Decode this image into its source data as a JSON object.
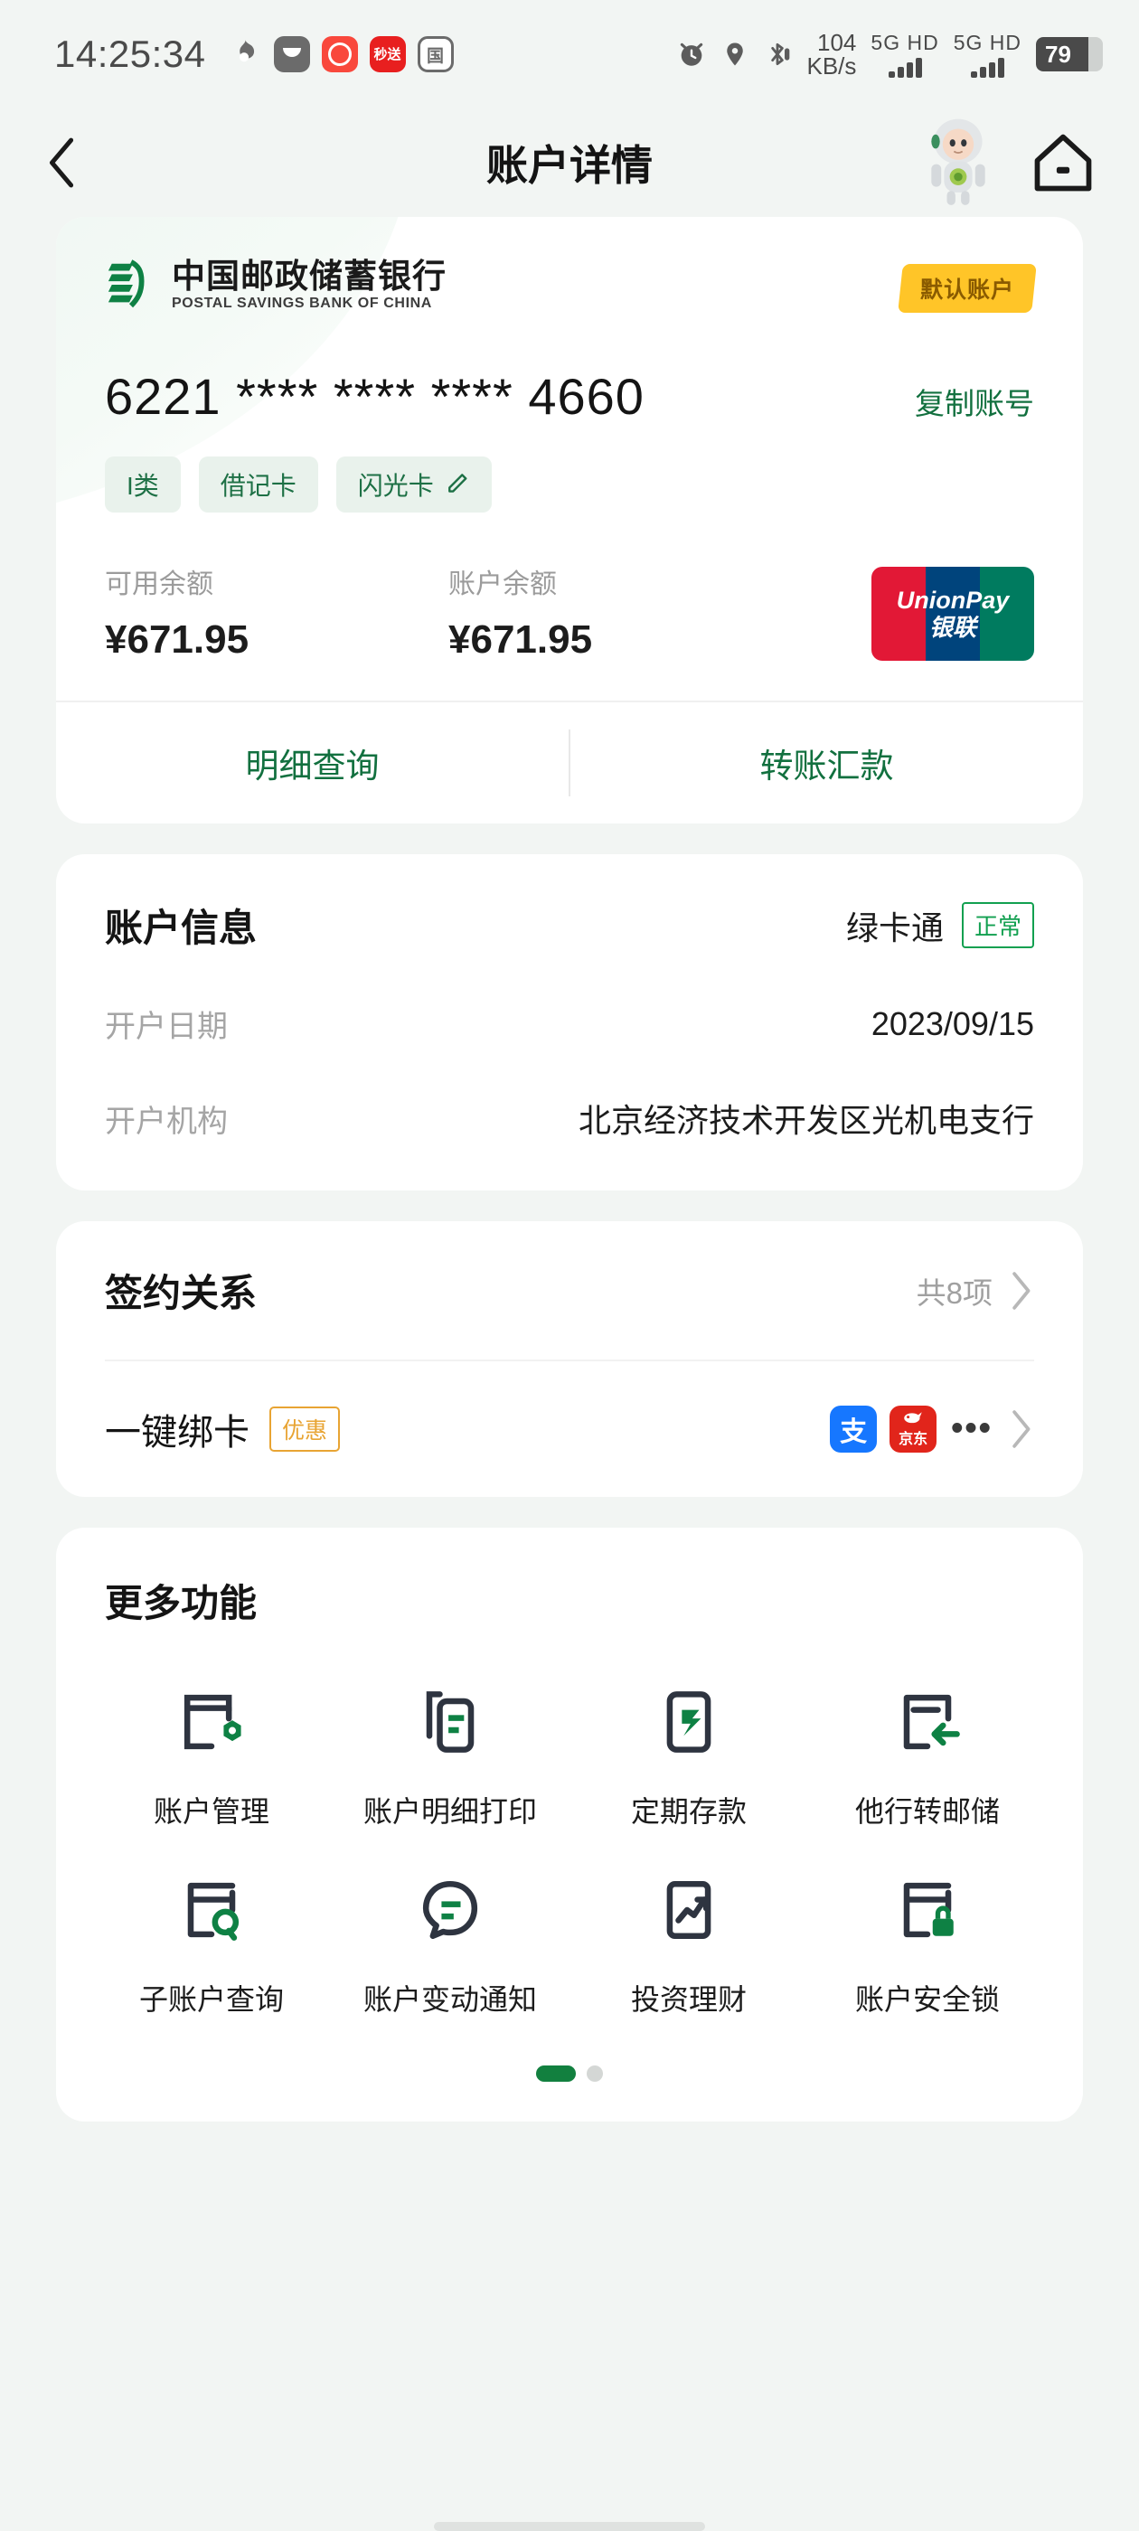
{
  "status_bar": {
    "time": "14:25:34",
    "app_icons": [
      "flame-icon",
      "mail-icon",
      "red-alarm-icon",
      "miaosong-icon",
      "guo-icon"
    ],
    "miaosong_label": "秒送",
    "guo_label": "国",
    "network_speed_value": "104",
    "network_speed_unit": "KB/s",
    "sim1_label": "5G HD",
    "sim2_label": "5G HD",
    "battery_level": "79"
  },
  "header": {
    "title": "账户详情",
    "back_icon": "chevron-left-icon",
    "mascot_icon": "robot-mascot-avatar",
    "home_icon": "home-icon"
  },
  "account_card": {
    "bank_name_cn": "中国邮政储蓄银行",
    "bank_name_en": "POSTAL SAVINGS BANK OF CHINA",
    "default_badge": "默认账户",
    "card_number": "6221 **** **** **** 4660",
    "copy_label": "复制账号",
    "tags": [
      "I类",
      "借记卡",
      "闪光卡"
    ],
    "edit_icon": "pencil-edit-icon",
    "available_balance_label": "可用余额",
    "available_balance_value": "¥671.95",
    "account_balance_label": "账户余额",
    "account_balance_value": "¥671.95",
    "unionpay_en": "UnionPay",
    "unionpay_cn": "银联",
    "action_detail": "明细查询",
    "action_transfer": "转账汇款"
  },
  "account_info": {
    "title": "账户信息",
    "account_type": "绿卡通",
    "status": "正常",
    "rows": [
      {
        "label": "开户日期",
        "value": "2023/09/15"
      },
      {
        "label": "开户机构",
        "value": "北京经济技术开发区光机电支行"
      }
    ]
  },
  "sign_section": {
    "title": "签约关系",
    "count_label": "共8项",
    "bind_title": "一键绑卡",
    "bind_badge": "优惠",
    "bind_icons": [
      "alipay-icon",
      "jd-icon"
    ],
    "alipay_glyph": "支",
    "jd_glyph": "京东",
    "more_dots": "•••"
  },
  "more_functions": {
    "title": "更多功能",
    "items": [
      {
        "label": "账户管理",
        "icon": "card-settings-icon"
      },
      {
        "label": "账户明细打印",
        "icon": "document-print-icon"
      },
      {
        "label": "定期存款",
        "icon": "deposit-transfer-icon"
      },
      {
        "label": "他行转邮储",
        "icon": "card-inbound-icon"
      },
      {
        "label": "子账户查询",
        "icon": "card-search-icon"
      },
      {
        "label": "账户变动通知",
        "icon": "notification-bubble-icon"
      },
      {
        "label": "投资理财",
        "icon": "chart-trend-icon"
      },
      {
        "label": "账户安全锁",
        "icon": "card-lock-icon"
      }
    ],
    "page_dots": 2,
    "active_page": 1
  },
  "colors": {
    "brand_green": "#12703f",
    "accent_yellow": "#ffc528",
    "promo_orange": "#e8a433",
    "status_green": "#12a050",
    "page_bg": "#f2f5f3"
  }
}
